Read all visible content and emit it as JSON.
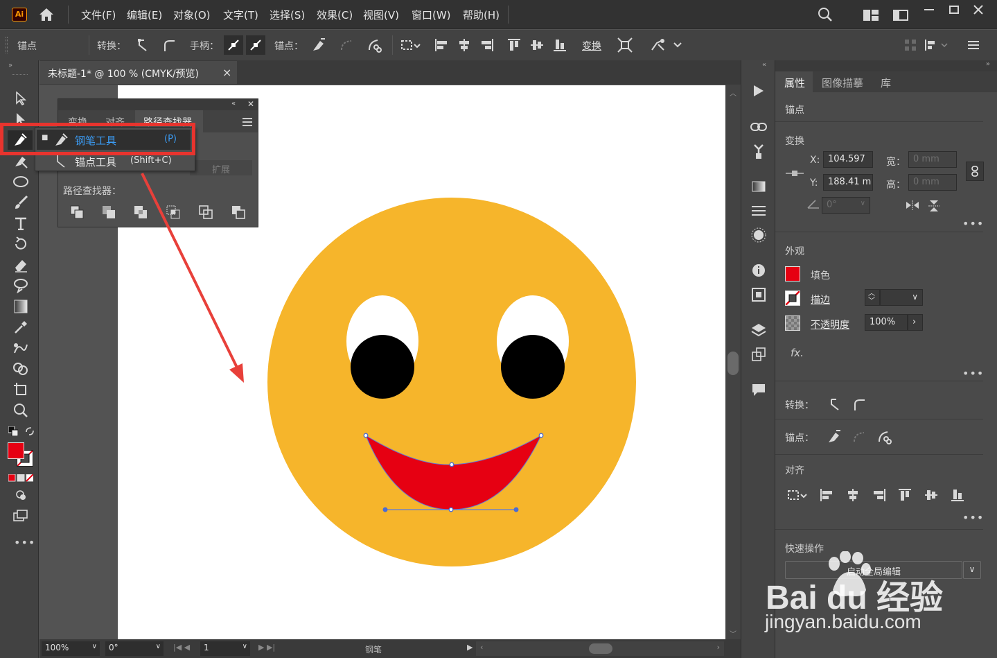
{
  "app": {
    "logo": "Ai"
  },
  "menu": [
    "文件(F)",
    "编辑(E)",
    "对象(O)",
    "文字(T)",
    "选择(S)",
    "效果(C)",
    "视图(V)",
    "窗口(W)",
    "帮助(H)"
  ],
  "control": {
    "anchor_label": "锚点",
    "convert_label": "转换：",
    "handle_label": "手柄：",
    "anchor2_label": "锚点：",
    "transform_label": "变换"
  },
  "document": {
    "tab_title": "未标题-1* @ 100 % (CMYK/预览)",
    "close": "×"
  },
  "pathfinder": {
    "tabs": [
      "变换",
      "对齐",
      "路径查找器"
    ],
    "expand_label": "扩展",
    "pathfinder_label": "路径查找器："
  },
  "flyout": {
    "items": [
      {
        "name": "钢笔工具",
        "shortcut": "(P)"
      },
      {
        "name": "锚点工具",
        "shortcut": "(Shift+C)"
      }
    ]
  },
  "properties": {
    "tabs": [
      "属性",
      "图像描摹",
      "库"
    ],
    "selection_label": "锚点",
    "transform": {
      "title": "变换",
      "x_label": "X:",
      "x_value": "104.597",
      "y_label": "Y:",
      "y_value": "188.41 m",
      "w_label": "宽：",
      "w_value": "0 mm",
      "h_label": "高：",
      "h_value": "0 mm",
      "angle_value": "0°"
    },
    "appearance": {
      "title": "外观",
      "fill_label": "填色",
      "stroke_label": "描边",
      "opacity_label": "不透明度",
      "opacity_value": "100%",
      "fx": "fx."
    },
    "convert_label": "转换：",
    "anchor_label": "锚点：",
    "align_title": "对齐",
    "quick_title": "快速操作",
    "quick_button": "启动全局编辑"
  },
  "status": {
    "zoom": "100%",
    "rotate": "0°",
    "page": "1",
    "tool": "钢笔"
  },
  "watermark": {
    "brand": "Bai du 经验",
    "url": "jingyan.baidu.com"
  },
  "colors": {
    "face": "#F6B52B",
    "mouth": "#E60012",
    "fill_swatch": "#E60012",
    "highlight_box": "#E8342E",
    "arrow": "#E8403A",
    "accent_text": "#3B9CF5"
  }
}
